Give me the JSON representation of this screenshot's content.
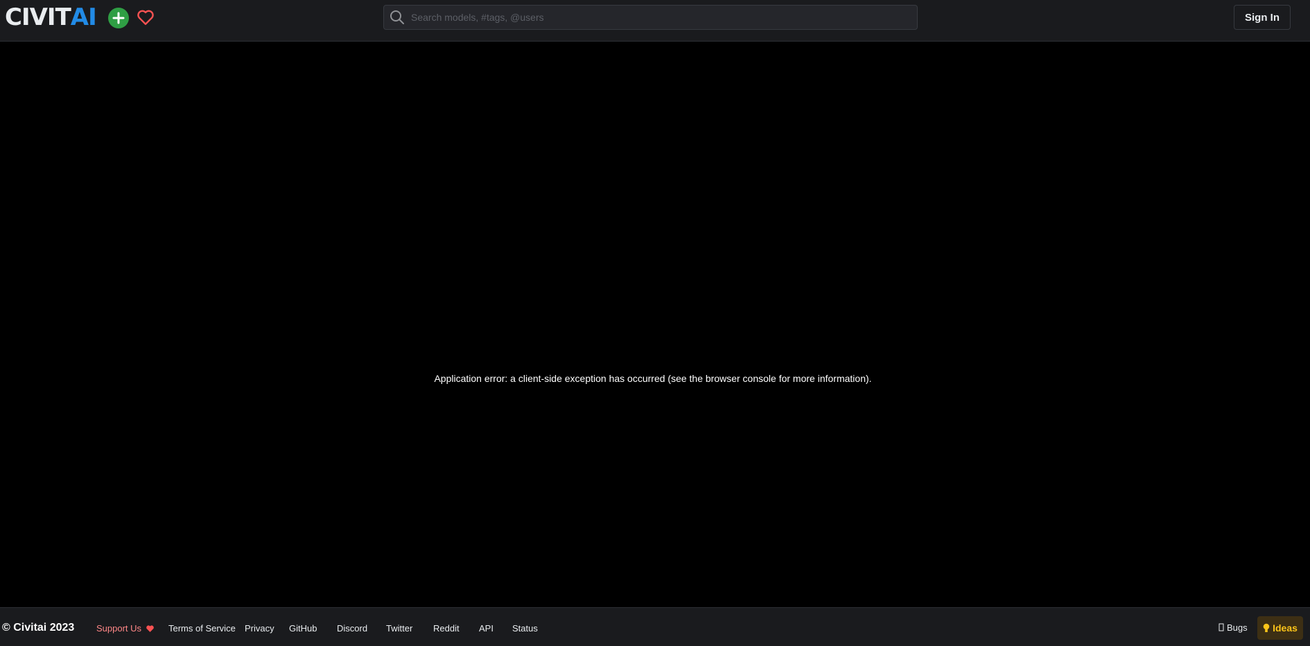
{
  "header": {
    "logo": {
      "part1": "CIVIT",
      "part2": "AI"
    },
    "search": {
      "placeholder": "Search models, #tags, @users"
    },
    "signin_label": "Sign In"
  },
  "main": {
    "error_message": "Application error: a client-side exception has occurred (see the browser console for more information)."
  },
  "footer": {
    "copyright": "© Civitai 2023",
    "support_label": "Support Us",
    "links": [
      "Terms of Service",
      "Privacy",
      "GitHub",
      "Discord",
      "Twitter",
      "Reddit",
      "API",
      "Status"
    ],
    "bugs_label": "Bugs",
    "ideas_label": "Ideas"
  },
  "colors": {
    "brand_blue": "#228be6",
    "upload_green": "#2f9e44",
    "heart_red": "#fa5252",
    "ideas_yellow": "#fcc419"
  },
  "icons": [
    "plus-icon",
    "heart-icon",
    "search-icon",
    "bug-icon",
    "bulb-icon"
  ]
}
